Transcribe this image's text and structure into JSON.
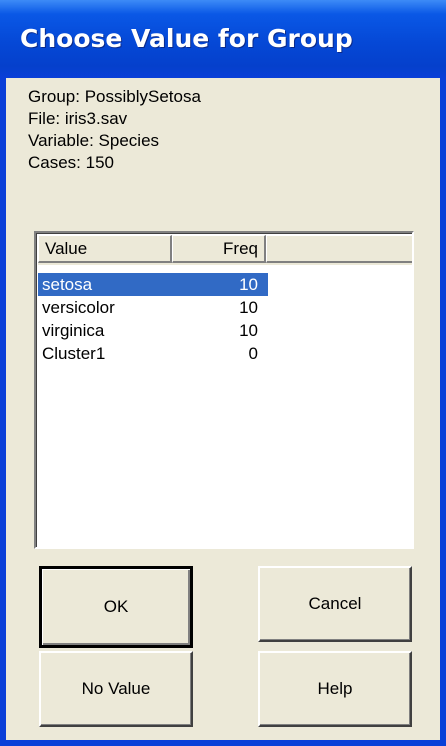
{
  "window": {
    "title": "Choose Value for Group"
  },
  "info": {
    "group": "Group: PossiblySetosa",
    "file": "File: iris3.sav",
    "variable": "Variable: Species",
    "cases": "Cases:  150"
  },
  "list": {
    "columns": [
      "Value",
      "Freq"
    ],
    "rows": [
      {
        "value": "setosa",
        "freq": "10",
        "selected": true
      },
      {
        "value": "versicolor",
        "freq": "10",
        "selected": false
      },
      {
        "value": "virginica",
        "freq": "10",
        "selected": false
      },
      {
        "value": "Cluster1",
        "freq": "0",
        "selected": false
      }
    ]
  },
  "buttons": {
    "ok": "OK",
    "cancel": "Cancel",
    "no_value": "No Value",
    "help": "Help"
  },
  "colors": {
    "titlebar": "#0548d6",
    "selection": "#316ac5",
    "dialog_bg": "#ece9d8"
  }
}
